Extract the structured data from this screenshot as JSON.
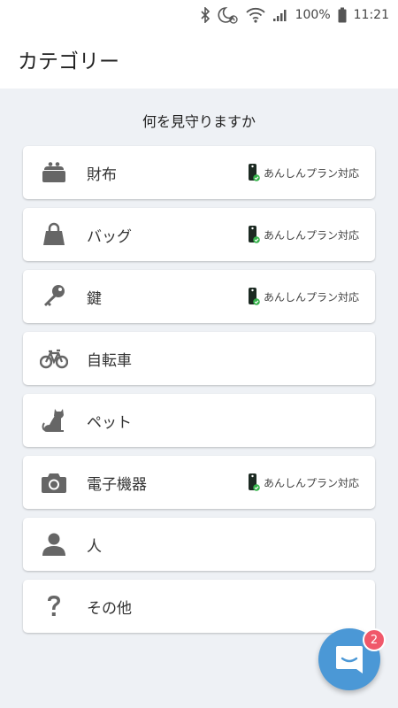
{
  "status_bar": {
    "battery": "100%",
    "time": "11:21",
    "icons": [
      "bluetooth-icon",
      "do-not-disturb-alarm-icon",
      "wifi-icon",
      "signal-icon"
    ]
  },
  "header": {
    "title": "カテゴリー"
  },
  "question": "何を見守りますか",
  "categories": [
    {
      "label": "財布",
      "icon": "wallet-icon",
      "plan": "あんしんプラン対応"
    },
    {
      "label": "バッグ",
      "icon": "bag-icon",
      "plan": "あんしんプラン対応"
    },
    {
      "label": "鍵",
      "icon": "key-icon",
      "plan": "あんしんプラン対応"
    },
    {
      "label": "自転車",
      "icon": "bicycle-icon",
      "plan": ""
    },
    {
      "label": "ペット",
      "icon": "pet-icon",
      "plan": ""
    },
    {
      "label": "電子機器",
      "icon": "camera-icon",
      "plan": "あんしんプラン対応"
    },
    {
      "label": "人",
      "icon": "person-icon",
      "plan": ""
    },
    {
      "label": "その他",
      "icon": "question-icon",
      "plan": ""
    }
  ],
  "chat": {
    "badge_count": "2",
    "icon": "chat-icon"
  },
  "colors": {
    "background": "#eef1f5",
    "icon_gray": "#666666",
    "tag_dark": "#1c2a22",
    "tag_check": "#35b34a",
    "chat_blue": "#4b98d6",
    "badge_red": "#f0586a"
  }
}
